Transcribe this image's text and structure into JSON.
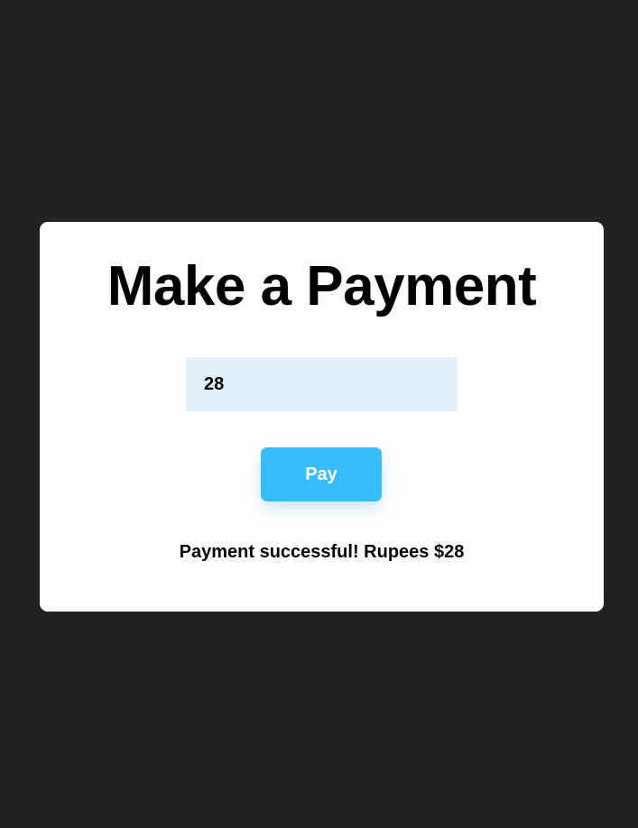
{
  "card": {
    "title": "Make a Payment"
  },
  "form": {
    "amount_value": "28",
    "pay_label": "Pay"
  },
  "status": {
    "message": "Payment successful! Rupees $28"
  },
  "colors": {
    "background": "#222222",
    "card": "#ffffff",
    "input_background": "#e0f1fc",
    "accent": "#38bdf8",
    "text": "#000000"
  }
}
